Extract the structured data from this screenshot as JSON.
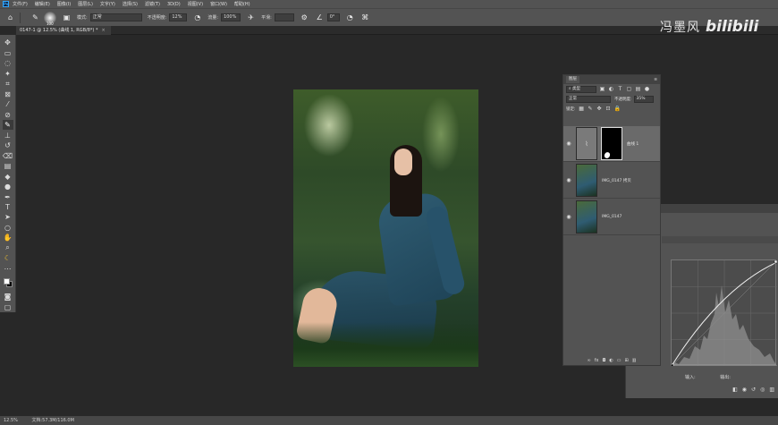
{
  "menu": {
    "items": [
      "文件(F)",
      "编辑(E)",
      "图像(I)",
      "图层(L)",
      "文字(Y)",
      "选择(S)",
      "滤镜(T)",
      "3D(D)",
      "视图(V)",
      "窗口(W)",
      "帮助(H)"
    ]
  },
  "options": {
    "brush_size": "100",
    "mode_label": "模式:",
    "mode_value": "正常",
    "opacity_label": "不透明度:",
    "opacity_value": "12%",
    "flow_label": "流量:",
    "flow_value": "100%",
    "smoothing_label": "平滑:",
    "angle_value": "0°"
  },
  "tab": {
    "title": "0147-1 @ 12.5% (曲线 1, RGB/8*) *",
    "close": "×"
  },
  "watermark": {
    "text": "冯墨风",
    "logo": "bilibili"
  },
  "layers": {
    "panel_title": "图层",
    "filter_label": "类型",
    "blend_mode": "正常",
    "opacity_label": "不透明度:",
    "opacity_value": "35%",
    "lock_label": "锁定:",
    "list": [
      {
        "name": "曲线 1",
        "type": "adjustment",
        "selected": true
      },
      {
        "name": "IMG_0147 拷贝",
        "type": "photo",
        "selected": false
      },
      {
        "name": "IMG_0147",
        "type": "photo",
        "selected": false
      }
    ],
    "footer_icons": [
      "link-icon",
      "fx-icon",
      "mask-icon",
      "adjustment-icon",
      "group-icon",
      "new-layer-icon",
      "trash-icon"
    ]
  },
  "properties": {
    "input_label": "输入:",
    "output_label": "输出:"
  },
  "status": {
    "zoom": "12.5%",
    "doc_info": "文档:57.3M/116.0M"
  },
  "colors": {
    "ui_dark": "#535353",
    "canvas_bg": "#282828",
    "accent": "#31a8ff"
  }
}
